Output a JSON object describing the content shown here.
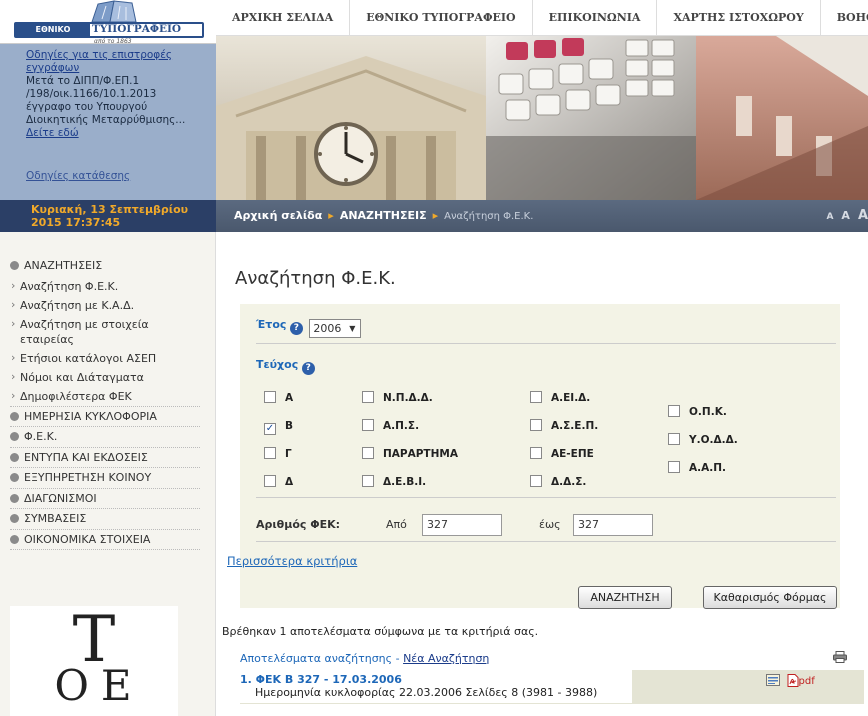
{
  "logo": {
    "left": "ΕΘΝΙΚΟ",
    "right": "ΤΥΠΟΓΡΑΦΕΙΟ",
    "since": "από το 1863"
  },
  "topnav": [
    {
      "label": "ΑΡΧΙΚΗ ΣΕΛΙΔΑ"
    },
    {
      "label": "ΕΘΝΙΚΟ ΤΥΠΟΓΡΑΦΕΙΟ"
    },
    {
      "label": "ΕΠΙΚΟΙΝΩΝΙΑ"
    },
    {
      "label": "ΧΑΡΤΗΣ ΙΣΤΟΧΩΡΟΥ"
    },
    {
      "label": "ΒΟΗΘΕΙΑ"
    }
  ],
  "news": {
    "link": "Οδηγίες για τις επιστροφές εγγράφων",
    "body": "Μετά το ΔΙΠΠ/Φ.ΕΠ.1\n/198/οικ.1166/10.1.2013\nέγγραφο του Υπουργού\nΔιοικητικής Μεταρρύθμισης...",
    "more": "Δείτε εδώ",
    "next": "Οδηγίες κατάθεσης"
  },
  "date": "Κυριακή, 13 Σεπτεμβρίου\n2015 17:37:45",
  "breadcrumb": {
    "home": "Αρχική σελίδα",
    "arrow": "▸",
    "section": "ΑΝΑΖΗΤΗΣΕΙΣ",
    "current": "Αναζήτηση Φ.Ε.Κ."
  },
  "font_size": [
    "A",
    "A",
    "A"
  ],
  "menu": {
    "searches": "ΑΝΑΖΗΤΗΣΕΙΣ",
    "sub": [
      "Αναζήτηση Φ.Ε.Κ.",
      "Αναζήτηση με Κ.Α.Δ.",
      "Αναζήτηση με στοιχεία εταιρείας",
      "Ετήσιοι κατάλογοι ΑΣΕΠ",
      "Νόμοι και Διάταγματα",
      "Δημοφιλέστερα ΦΕΚ"
    ],
    "sections": [
      "ΗΜΕΡΗΣΙΑ ΚΥΚΛΟΦΟΡΙΑ",
      "Φ.Ε.Κ.",
      "ΕΝΤΥΠΑ ΚΑΙ ΕΚΔΟΣΕΙΣ",
      "ΕΞΥΠΗΡΕΤΗΣΗ ΚΟΙΝΟΥ",
      "ΔΙΑΓΩΝΙΣΜΟΙ",
      "ΣΥΜΒΑΣΕΙΣ",
      "ΟΙΚΟΝΟΜΙΚΑ ΣΤΟΙΧΕΙΑ"
    ]
  },
  "toe": {
    "t": "Τ",
    "oe": "ΟΕ"
  },
  "page_title": "Αναζήτηση Φ.Ε.Κ.",
  "form": {
    "year_label": "Έτος",
    "year_value": "2006",
    "issue_label": "Τεύχος",
    "help": "?",
    "issues": [
      {
        "label": "Α",
        "checked": false
      },
      {
        "label": "Β",
        "checked": true
      },
      {
        "label": "Γ",
        "checked": false
      },
      {
        "label": "Δ",
        "checked": false
      },
      {
        "label": "Ν.Π.Δ.Δ.",
        "checked": false
      },
      {
        "label": "Α.Π.Σ.",
        "checked": false
      },
      {
        "label": "ΠΑΡΑΡΤΗΜΑ",
        "checked": false
      },
      {
        "label": "Δ.Ε.Β.Ι.",
        "checked": false
      },
      {
        "label": "Α.ΕΙ.Δ.",
        "checked": false
      },
      {
        "label": "Α.Σ.Ε.Π.",
        "checked": false
      },
      {
        "label": "ΑΕ-ΕΠΕ",
        "checked": false
      },
      {
        "label": "Δ.Δ.Σ.",
        "checked": false
      },
      {
        "label": "Ο.Π.Κ.",
        "checked": false
      },
      {
        "label": "Υ.Ο.Δ.Δ.",
        "checked": false
      },
      {
        "label": "Α.Α.Π.",
        "checked": false
      }
    ],
    "fek_label": "Αριθμός ΦΕΚ:",
    "from_label": "Από",
    "from_value": "327",
    "to_label": "έως",
    "to_value": "327",
    "more_criteria": "Περισσότερα κριτήρια",
    "search_button": "ΑΝΑΖΗΤΗΣΗ",
    "clear_button": "Καθαρισμός Φόρμας"
  },
  "results": {
    "count_text": "Βρέθηκαν 1 αποτελέσματα σύμφωνα με τα κριτήριά σας.",
    "label": "Αποτελέσματα αναζήτησης - ",
    "new_search": "Νέα Αναζήτηση",
    "item": {
      "title": "1. ΦΕΚ B 327 - 17.03.2006",
      "meta": "Ημερομηνία κυκλοφορίας 22.03.2006 Σελίδες 8 (3981 - 3988)",
      "pdf": "pdf"
    }
  },
  "colors": {
    "accent_blue": "#1d67b8",
    "date_orange": "#f0a92a",
    "news_bg": "#9aaeca"
  }
}
